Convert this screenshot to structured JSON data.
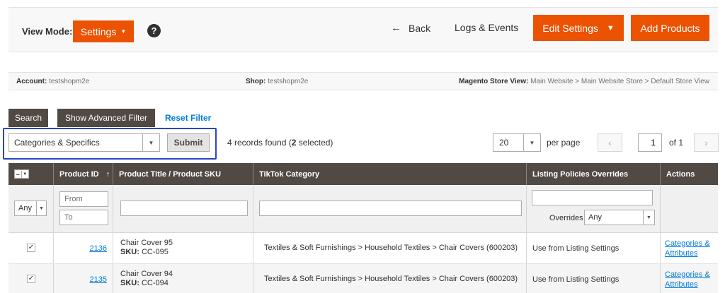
{
  "header": {
    "view_mode_label": "View Mode:",
    "view_mode_value": "Settings",
    "help_icon": "?",
    "back_label": "Back",
    "logs_label": "Logs & Events",
    "edit_settings_label": "Edit Settings",
    "add_products_label": "Add Products"
  },
  "info": {
    "account_key": "Account:",
    "account_value": "testshopm2e",
    "shop_key": "Shop:",
    "shop_value": "testshopm2e",
    "store_view_key": "Magento Store View:",
    "store_view_value": "Main Website > Main Website Store > Default Store View"
  },
  "filters": {
    "search_label": "Search",
    "advanced_filter_label": "Show Advanced Filter",
    "reset_label": "Reset Filter"
  },
  "mass_action": {
    "selected_action": "Categories & Specifics",
    "submit_label": "Submit",
    "records_prefix": "4 records found (",
    "selected_count": "2",
    "records_suffix": " selected)"
  },
  "pager": {
    "per_page_value": "20",
    "per_page_label": "per page",
    "prev_icon": "‹",
    "next_icon": "›",
    "current_page": "1",
    "of_label": "of 1"
  },
  "grid": {
    "columns": {
      "product_id": "Product ID",
      "title_sku": "Product Title / Product SKU",
      "tiktok_category": "TikTok Category",
      "listing_policies": "Listing Policies Overrides",
      "actions": "Actions"
    },
    "filter_row": {
      "any_value": "Any",
      "from_placeholder": "From",
      "to_placeholder": "To",
      "overrides_label": "Overrides",
      "overrides_value": "Any"
    },
    "rows": [
      {
        "checked": "✓",
        "product_id": "2136",
        "title": "Chair Cover 95",
        "sku_label": "SKU:",
        "sku": "CC-095",
        "category": "Textiles & Soft Furnishings > Household Textiles > Chair Covers (600203)",
        "policy": "Use from Listing Settings",
        "action_line1": "Categories &",
        "action_line2": "Attributes"
      },
      {
        "checked": "✓",
        "product_id": "2135",
        "title": "Chair Cover 94",
        "sku_label": "SKU:",
        "sku": "CC-094",
        "category": "Textiles & Soft Furnishings > Household Textiles > Chair Covers (600203)",
        "policy": "Use from Listing Settings",
        "action_line1": "Categories &",
        "action_line2": "Attributes"
      }
    ]
  }
}
